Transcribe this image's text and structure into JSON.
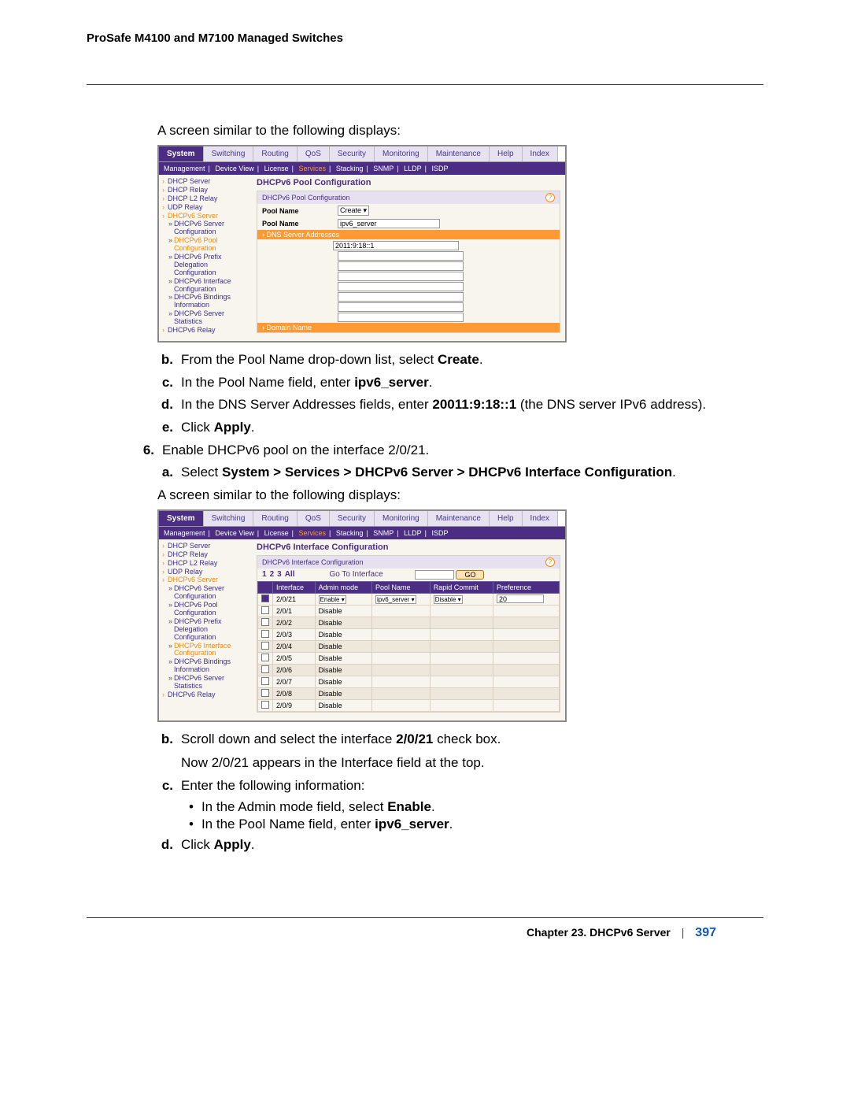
{
  "doc_header": "ProSafe M4100 and M7100 Managed Switches",
  "intro1": "A screen similar to the following displays:",
  "screenshot1": {
    "tabs": [
      "System",
      "Switching",
      "Routing",
      "QoS",
      "Security",
      "Monitoring",
      "Maintenance",
      "Help",
      "Index"
    ],
    "active_tab": "System",
    "subtabs": [
      "Management",
      "Device View",
      "License",
      "Services",
      "Stacking",
      "SNMP",
      "LLDP",
      "ISDP"
    ],
    "active_subtab": "Services",
    "sidebar": [
      {
        "l": "DHCP Server"
      },
      {
        "l": "DHCP Relay"
      },
      {
        "l": "DHCP L2 Relay"
      },
      {
        "l": "UDP Relay"
      },
      {
        "l": "DHCPv6 Server",
        "o": true
      },
      {
        "l": "DHCPv6 Server Configuration",
        "sub": true
      },
      {
        "l": "DHCPv6 Pool Configuration",
        "sub": true,
        "o": true
      },
      {
        "l": "DHCPv6 Prefix Delegation Configuration",
        "sub": true
      },
      {
        "l": "DHCPv6 Interface Configuration",
        "sub": true
      },
      {
        "l": "DHCPv6 Bindings Information",
        "sub": true
      },
      {
        "l": "DHCPv6 Server Statistics",
        "sub": true
      },
      {
        "l": "DHCPv6 Relay"
      }
    ],
    "panel_title": "DHCPv6 Pool Configuration",
    "panel_sub": "DHCPv6 Pool Configuration",
    "pool_name_label": "Pool Name",
    "pool_name_select": "Create",
    "pool_name_label2": "Pool Name",
    "pool_name_value": "ipv6_server",
    "dns_bar": "DNS Server Addresses",
    "dns_value": "2011:9:18::1",
    "domain_bar": "Domain Name"
  },
  "step_b": {
    "m": "b.",
    "t_pre": "From the Pool Name drop-down list, select ",
    "t_bold": "Create",
    "t_post": "."
  },
  "step_c": {
    "m": "c.",
    "t_pre": "In the Pool Name field, enter ",
    "t_bold": "ipv6_server",
    "t_post": "."
  },
  "step_d": {
    "m": "d.",
    "t_pre": "In the DNS Server Addresses fields, enter ",
    "t_bold": "20011:9:18::1",
    "t_post": " (the DNS server IPv6 address)."
  },
  "step_e": {
    "m": "e.",
    "t_pre": "Click ",
    "t_bold": "Apply",
    "t_post": "."
  },
  "step_6": {
    "m": "6.",
    "t": "Enable DHCPv6 pool on the interface 2/0/21."
  },
  "step_6a": {
    "m": "a.",
    "t_pre": "Select ",
    "t_bold": "System > Services > DHCPv6 Server > DHCPv6 Interface Configuration",
    "t_post": "."
  },
  "intro2": "A screen similar to the following displays:",
  "screenshot2": {
    "tabs": [
      "System",
      "Switching",
      "Routing",
      "QoS",
      "Security",
      "Monitoring",
      "Maintenance",
      "Help",
      "Index"
    ],
    "active_tab": "System",
    "subtabs": [
      "Management",
      "Device View",
      "License",
      "Services",
      "Stacking",
      "SNMP",
      "LLDP",
      "ISDP"
    ],
    "active_subtab": "Services",
    "sidebar": [
      {
        "l": "DHCP Server"
      },
      {
        "l": "DHCP Relay"
      },
      {
        "l": "DHCP L2 Relay"
      },
      {
        "l": "UDP Relay"
      },
      {
        "l": "DHCPv6 Server",
        "o": true
      },
      {
        "l": "DHCPv6 Server Configuration",
        "sub": true
      },
      {
        "l": "DHCPv6 Pool Configuration",
        "sub": true
      },
      {
        "l": "DHCPv6 Prefix Delegation Configuration",
        "sub": true
      },
      {
        "l": "DHCPv6 Interface Configuration",
        "sub": true,
        "o": true
      },
      {
        "l": "DHCPv6 Bindings Information",
        "sub": true
      },
      {
        "l": "DHCPv6 Server Statistics",
        "sub": true
      },
      {
        "l": "DHCPv6 Relay"
      }
    ],
    "panel_title": "DHCPv6 Interface Configuration",
    "panel_sub": "DHCPv6 Interface Configuration",
    "nums": [
      "1",
      "2",
      "3",
      "All"
    ],
    "gti": "Go To Interface",
    "go": "GO",
    "cols": [
      "",
      "Interface",
      "Admin mode",
      "Pool Name",
      "Rapid Commit",
      "Preference"
    ],
    "top_row": {
      "checked": true,
      "iface": "2/0/21",
      "admin": "Enable",
      "pool": "ipv6_server",
      "rapid": "Disable",
      "pref": "20"
    },
    "rows": [
      {
        "iface": "2/0/1",
        "admin": "Disable"
      },
      {
        "iface": "2/0/2",
        "admin": "Disable",
        "alt": true
      },
      {
        "iface": "2/0/3",
        "admin": "Disable"
      },
      {
        "iface": "2/0/4",
        "admin": "Disable",
        "alt": true
      },
      {
        "iface": "2/0/5",
        "admin": "Disable"
      },
      {
        "iface": "2/0/6",
        "admin": "Disable",
        "alt": true
      },
      {
        "iface": "2/0/7",
        "admin": "Disable"
      },
      {
        "iface": "2/0/8",
        "admin": "Disable",
        "alt": true
      },
      {
        "iface": "2/0/9",
        "admin": "Disable"
      }
    ]
  },
  "step_6b": {
    "m": "b.",
    "t_pre": "Scroll down and select the interface ",
    "t_bold": "2/0/21",
    "t_post": " check box.",
    "t_line2": "Now 2/0/21 appears in the Interface field at the top."
  },
  "step_6c": {
    "m": "c.",
    "t": "Enter the following information:"
  },
  "bullet1": {
    "t_pre": "In the Admin mode field, select ",
    "t_bold": "Enable",
    "t_post": "."
  },
  "bullet2": {
    "t_pre": "In the Pool Name field, enter ",
    "t_bold": "ipv6_server",
    "t_post": "."
  },
  "step_6d": {
    "m": "d.",
    "t_pre": "Click ",
    "t_bold": "Apply",
    "t_post": "."
  },
  "footer": {
    "chapter": "Chapter 23.  DHCPv6 Server",
    "page": "397"
  }
}
